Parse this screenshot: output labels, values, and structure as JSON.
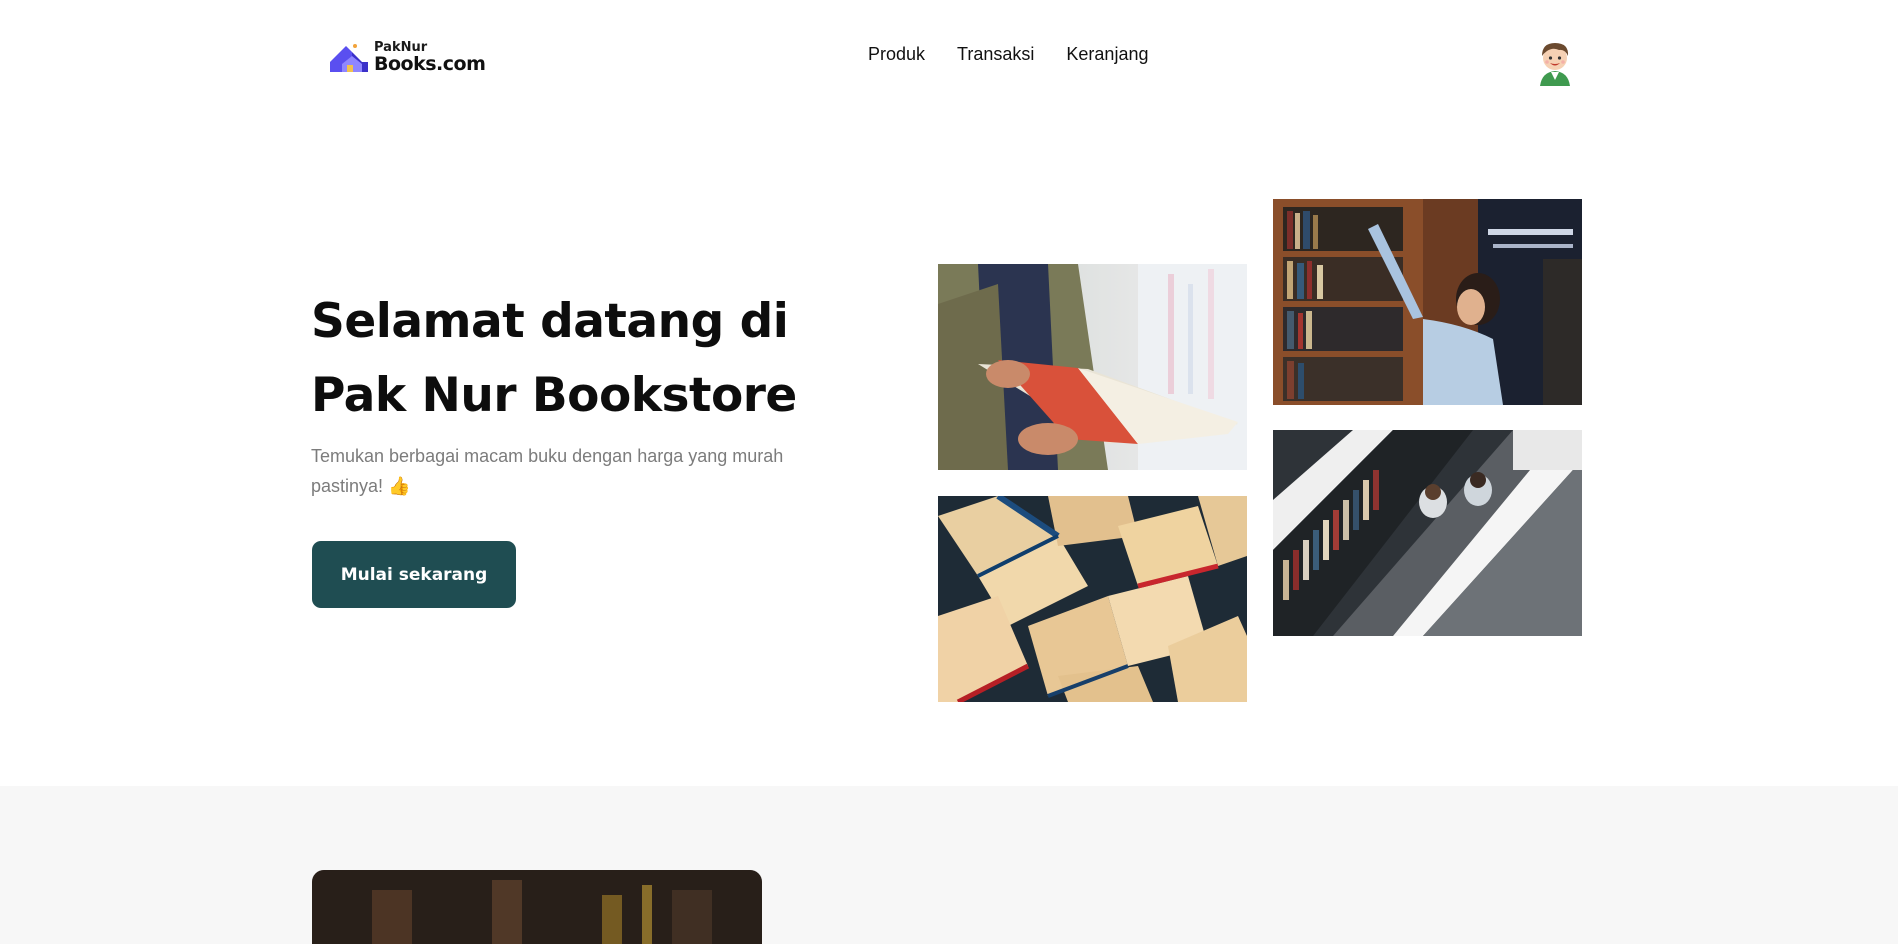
{
  "header": {
    "logo": {
      "line1": "PakNur",
      "line2": "Books.com",
      "icon": "house-logo-icon"
    },
    "nav": [
      {
        "label": "Produk"
      },
      {
        "label": "Transaksi"
      },
      {
        "label": "Keranjang"
      }
    ],
    "avatar_icon": "user-avatar-icon"
  },
  "hero": {
    "title_line1": "Selamat datang di",
    "title_line2": "Pak Nur Bookstore",
    "subtitle": "Temukan berbagai macam buku dengan harga yang murah pastinya! 👍",
    "cta_label": "Mulai sekarang"
  },
  "gallery": [
    {
      "subject": "person-reading-red-book"
    },
    {
      "subject": "woman-reaching-library-shelf"
    },
    {
      "subject": "pile-of-open-books"
    },
    {
      "subject": "overhead-library-aisle"
    }
  ],
  "colors": {
    "primary": "#1f4d52",
    "text": "#0d0d0d",
    "muted": "#7c7c7c",
    "section_bg": "#f7f7f7",
    "logo_accent": "#4a3fd8"
  }
}
